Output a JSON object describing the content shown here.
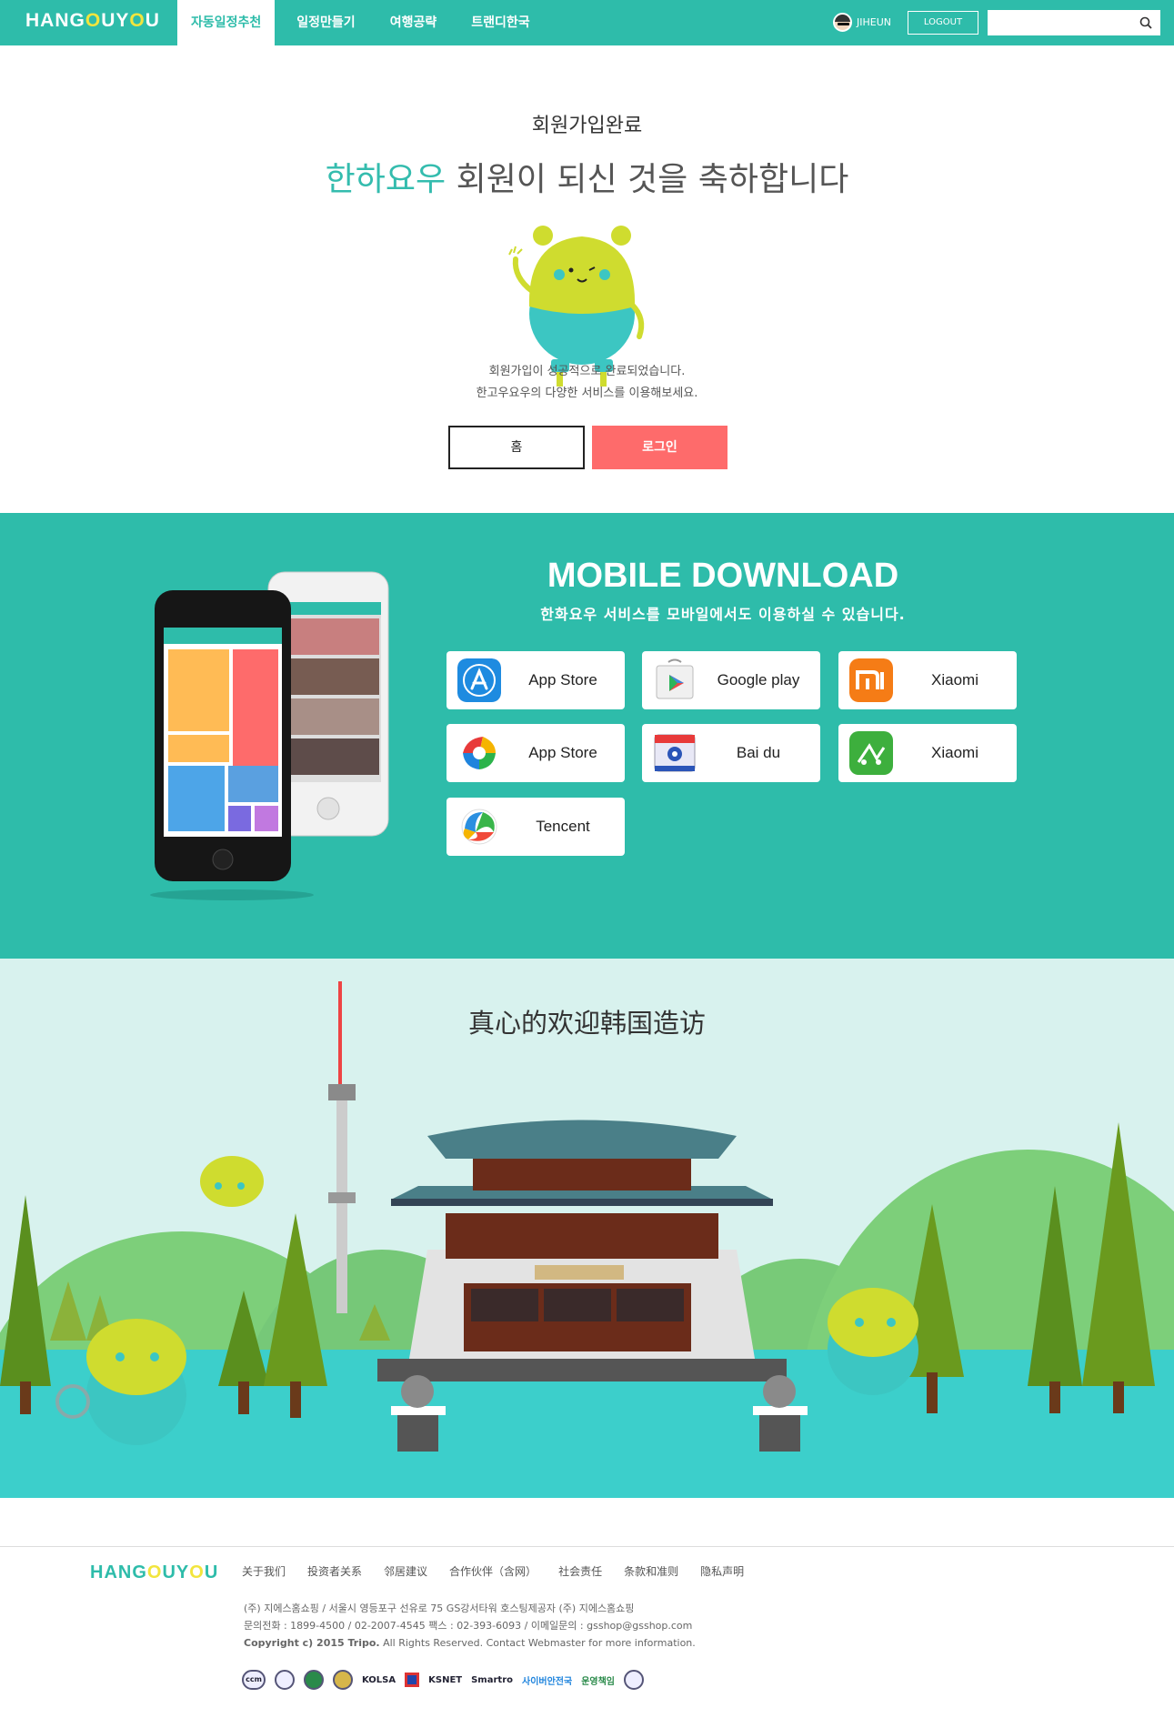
{
  "header": {
    "logo_prefix": "HANG",
    "logo_o": "O",
    "logo_mid": "UY",
    "logo_o2": "O",
    "logo_suffix": "U",
    "nav": [
      {
        "label": "자동일정추천",
        "active": true
      },
      {
        "label": "일정만들기",
        "active": false
      },
      {
        "label": "여행공략",
        "active": false
      },
      {
        "label": "트랜디한국",
        "active": false
      }
    ],
    "username": "JIHEUN",
    "logout_label": "LOGOUT",
    "search_placeholder": ""
  },
  "signup": {
    "title": "회원가입완료",
    "congrats_brand": "한하요우",
    "congrats_rest": " 회원이 되신 것을 축하합니다",
    "message_line1": "회원가입이 성공적으로 완료되었습니다.",
    "message_line2": "한고우요우의 다양한 서비스를 이용해보세요.",
    "home_label": "홈",
    "login_label": "로그인"
  },
  "mobile": {
    "title": "MOBILE DOWNLOAD",
    "subtitle": "한화요우 서비스를 모바일에서도 이용하실 수 있습니다.",
    "stores": [
      {
        "label": "App Store",
        "icon": "app-store-icon"
      },
      {
        "label": "Google play",
        "icon": "google-play-icon"
      },
      {
        "label": "Xiaomi",
        "icon": "xiaomi-icon"
      },
      {
        "label": "App Store",
        "icon": "qihoo-store-icon"
      },
      {
        "label": "Bai du",
        "icon": "baidu-icon"
      },
      {
        "label": "Xiaomi",
        "icon": "wandoujia-icon"
      },
      {
        "label": "Tencent",
        "icon": "tencent-icon"
      }
    ]
  },
  "welcome": {
    "title": "真心的欢迎韩国造访"
  },
  "footer": {
    "links": [
      "关于我们",
      "投资者关系",
      "邻居建议",
      "合作伙伴（含网）",
      "社会责任",
      "条款和准则",
      "隐私声明"
    ],
    "info_line1": "(주) 지에스홈쇼핑  / 서울시 영등포구 선유로 75 GS강서타워 호스팅제공자 (주) 지에스홈쇼핑",
    "info_line2": "문의전화 : 1899-4500 / 02-2007-4545 팩스 : 02-393-6093 / 이메일문의 : gsshop@gsshop.com",
    "copyright_bold": "Copyright c) 2015 Tripo.",
    "copyright_rest": " All Rights Reserved. Contact Webmaster for more information.",
    "badges": [
      "ccm",
      "",
      "",
      "",
      "KOLSA",
      "",
      "KSNET",
      "Smartro",
      "사이버안전국",
      "운영책임"
    ]
  },
  "colors": {
    "brand": "#2ebcaa",
    "accent": "#fe6b6b",
    "yellow": "#f2e53d"
  }
}
